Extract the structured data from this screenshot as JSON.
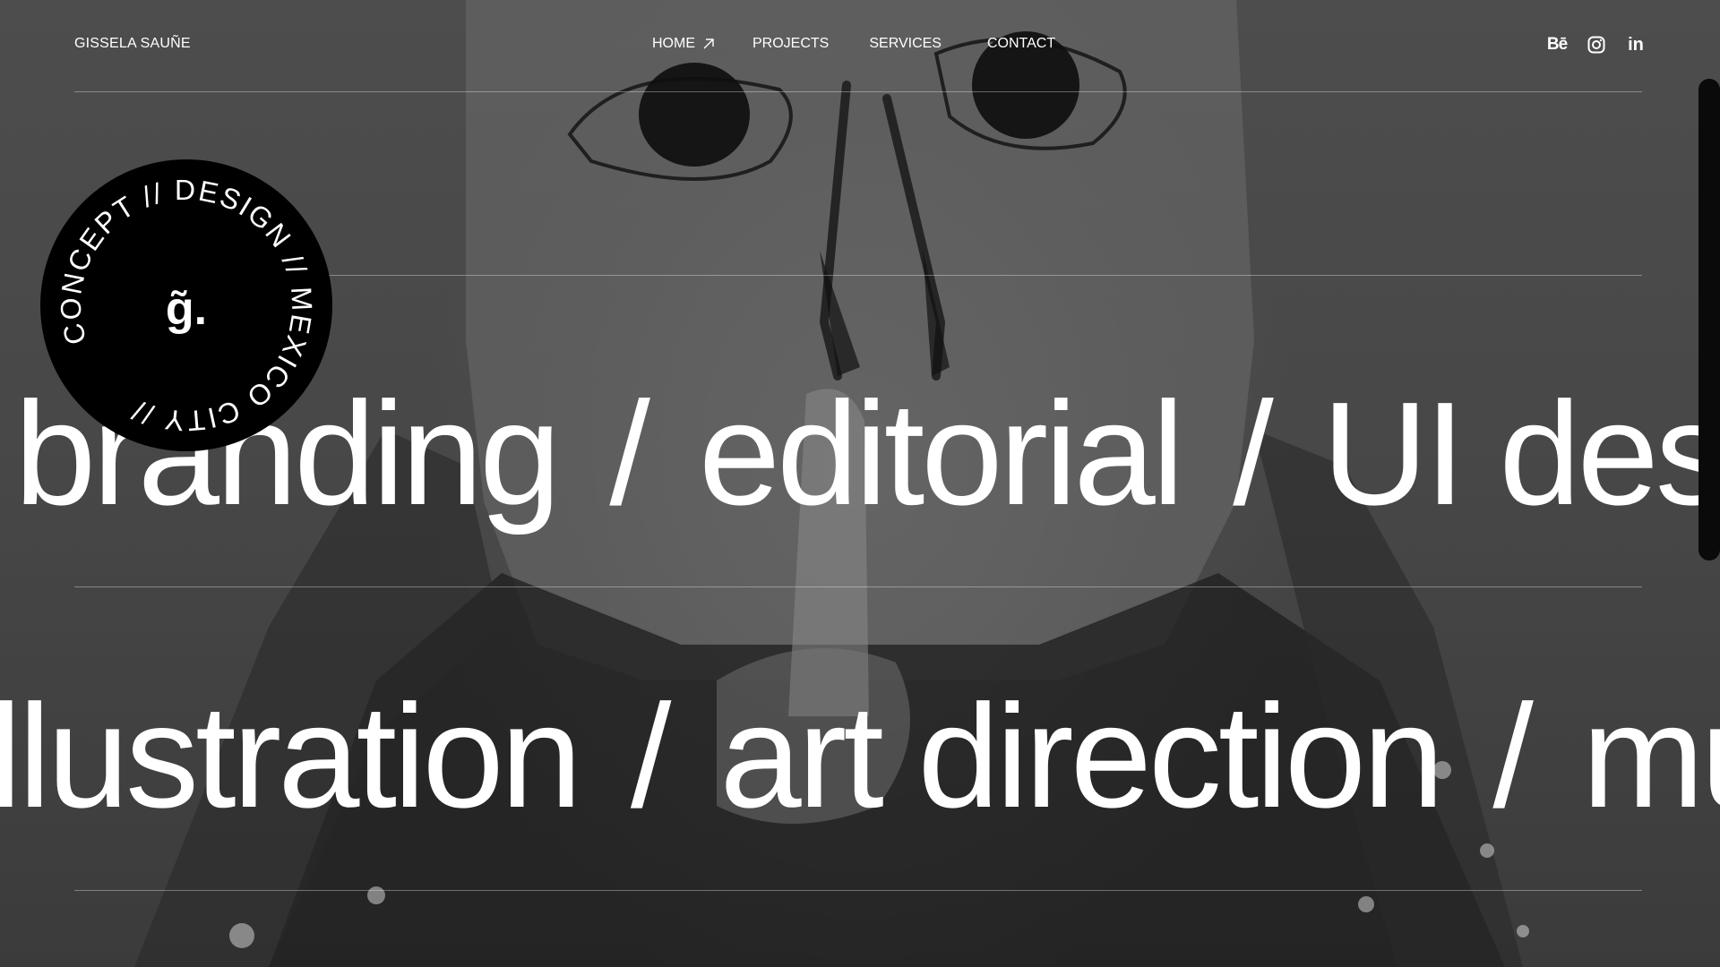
{
  "brand": "GISSELA SAUÑE",
  "nav": {
    "home": "HOME",
    "projects": "PROJECTS",
    "services": "SERVICES",
    "contact": "CONTACT"
  },
  "socials": {
    "behance": "Bē",
    "instagram": "instagram-icon",
    "linkedin": "in"
  },
  "marquee": {
    "row1": [
      "branding",
      "/",
      "editorial",
      "/",
      "UI des"
    ],
    "row2": [
      "llustration",
      "/",
      "art direction",
      "/",
      "mu"
    ]
  },
  "badge": {
    "mark": "g̃.",
    "ring_text": "CONCEPT  //  DESIGN  //  MEXICO CITY  //"
  },
  "colors": {
    "text": "#ffffff",
    "badge": "#000000",
    "divider": "rgba(255,255,255,0.35)"
  }
}
